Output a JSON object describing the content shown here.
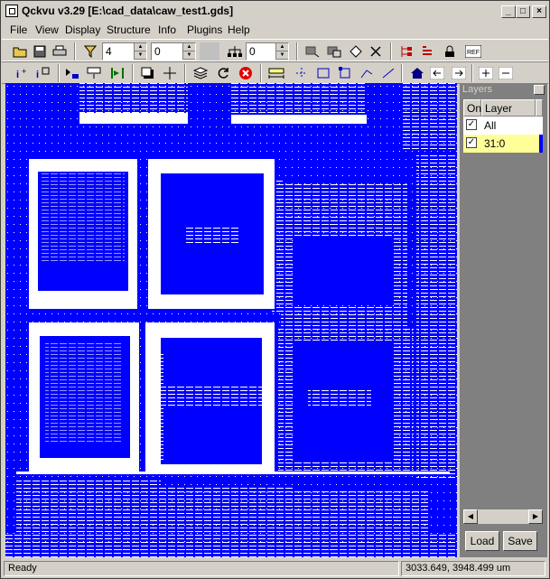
{
  "window": {
    "title": "Qckvu v3.29 [E:\\cad_data\\caw_test1.gds]"
  },
  "menu": [
    "File",
    "View",
    "Display",
    "Structure",
    "Info",
    "Plugins",
    "Help"
  ],
  "toolbar1": {
    "filter_level": "4",
    "filter_value": "0",
    "depth_value": "0"
  },
  "layers_panel": {
    "title": "Layers",
    "columns": [
      "On",
      "Layer"
    ],
    "rows": [
      {
        "on": true,
        "layer": "All",
        "selected": false
      },
      {
        "on": true,
        "layer": "31:0",
        "selected": true
      }
    ],
    "load_label": "Load",
    "save_label": "Save"
  },
  "status": {
    "state": "Ready",
    "coordinates": "3033.649, 3948.499 um"
  },
  "colors": {
    "canvas": "#0000ff",
    "geometry": "#ffffff",
    "selected_row": "#ffff99"
  }
}
